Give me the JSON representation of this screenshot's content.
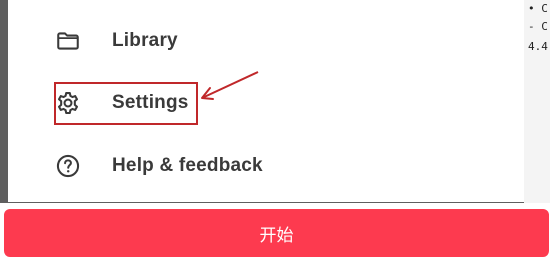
{
  "drawer": {
    "items": [
      {
        "label": "Library",
        "icon": "folder-icon"
      },
      {
        "label": "Settings",
        "icon": "gear-icon"
      },
      {
        "label": "Help & feedback",
        "icon": "help-icon"
      }
    ]
  },
  "background_snippet": {
    "lines": [
      "• C",
      "- C",
      "4.4"
    ]
  },
  "start_button": {
    "label": "开始"
  },
  "colors": {
    "highlight": "#c0282a",
    "start_button": "#fd3a4f",
    "menu_text": "#3a3a3a"
  }
}
